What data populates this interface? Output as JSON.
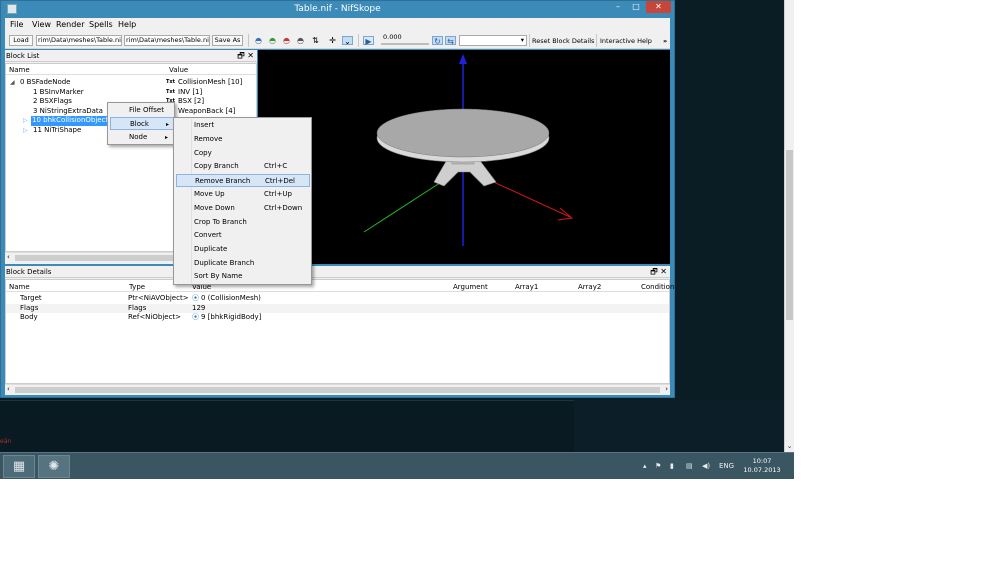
{
  "window": {
    "title": "Table.nif - NifSkope",
    "icon": "nifskope-app-icon",
    "controls": {
      "minimize": "–",
      "maximize": "□",
      "close": "✕"
    }
  },
  "menubar": [
    "File",
    "View",
    "Render",
    "Spells",
    "Help"
  ],
  "toolbar": {
    "load_label": "Load",
    "load_path": "rim\\Data\\meshes\\Table.nif",
    "save_path": "rim\\Data\\meshes\\Table.nif",
    "save_label": "Save As",
    "frame_value": "0.000",
    "reset_label": "Reset Block Details",
    "help_label": "Interactive Help",
    "overflow": "»"
  },
  "blocklist": {
    "title": "Block List",
    "dock_buttons": "🗗 ✕",
    "columns": [
      "Name",
      "Value"
    ],
    "rows": [
      {
        "expander": "◢",
        "name": "0 BSFadeNode",
        "tag": "Txt",
        "value": "CollisionMesh [10]"
      },
      {
        "expander": "",
        "name": "1 BSInvMarker",
        "tag": "Txt",
        "value": "INV [1]"
      },
      {
        "expander": "",
        "name": "2 BSXFlags",
        "tag": "Txt",
        "value": "BSX [2]"
      },
      {
        "expander": "",
        "name": "3 NiStringExtraData",
        "tag": "",
        "value": "WeaponBack [4]"
      },
      {
        "expander": "▷",
        "name": "10 bhkCollisionObject",
        "tag": "",
        "value": ""
      },
      {
        "expander": "▷",
        "name": "11 NiTriShape",
        "tag": "",
        "value": ""
      }
    ]
  },
  "context_menu": {
    "items": [
      "File Offset",
      "Block",
      "Node"
    ]
  },
  "block_submenu": {
    "items": [
      {
        "label": "Insert",
        "shortcut": ""
      },
      {
        "label": "Remove",
        "shortcut": ""
      },
      {
        "label": "Copy",
        "shortcut": ""
      },
      {
        "label": "Copy Branch",
        "shortcut": "Ctrl+C"
      },
      {
        "label": "Remove Branch",
        "shortcut": "Ctrl+Del"
      },
      {
        "label": "Move Up",
        "shortcut": "Ctrl+Up"
      },
      {
        "label": "Move Down",
        "shortcut": "Ctrl+Down"
      },
      {
        "label": "Crop To Branch",
        "shortcut": ""
      },
      {
        "label": "Convert",
        "shortcut": ""
      },
      {
        "label": "Duplicate",
        "shortcut": ""
      },
      {
        "label": "Duplicate Branch",
        "shortcut": ""
      },
      {
        "label": "Sort By Name",
        "shortcut": ""
      }
    ]
  },
  "details": {
    "title": "Block Details",
    "dock_buttons": "🗗 ✕",
    "columns": [
      "Name",
      "Type",
      "Value",
      "Argument",
      "Array1",
      "Array2",
      "Condition"
    ],
    "rows": [
      {
        "name": "Target",
        "type": "Ptr<NiAVObject>",
        "value": "0 (CollisionMesh)"
      },
      {
        "name": "Flags",
        "type": "Flags",
        "value": "129"
      },
      {
        "name": "Body",
        "type": "Ref<NiObject>",
        "value": "9 [bhkRigidBody]"
      }
    ]
  },
  "viewport": {
    "background": "#000000",
    "axis_x_color": "#d01818",
    "axis_y_color": "#22b522",
    "axis_z_color": "#2020e0",
    "mesh_color": "#a8a8a8"
  },
  "console": {
    "text": "eän"
  },
  "taskbar": {
    "apps": [
      "file-manager-icon",
      "nifskope-taskbar-icon"
    ],
    "tray": {
      "lang": "ENG",
      "time": "10:07",
      "date": "10.07.2013"
    }
  }
}
